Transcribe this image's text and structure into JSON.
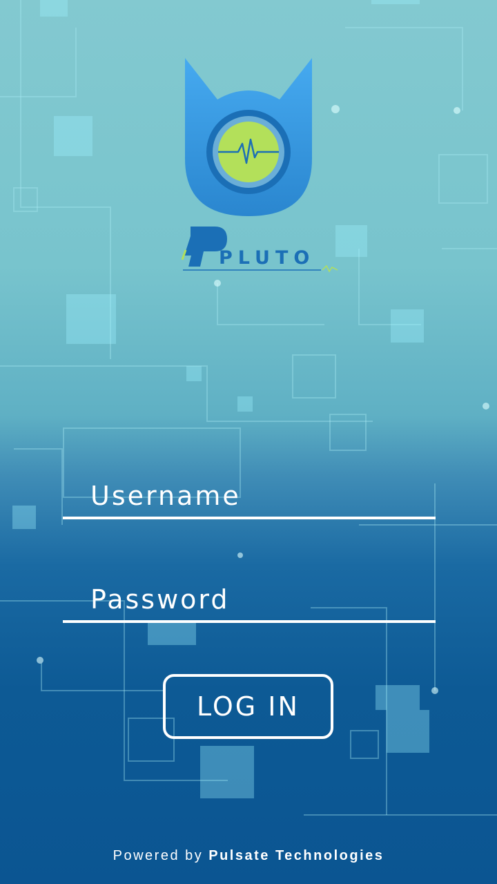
{
  "app": {
    "logo_text": "PLUTO"
  },
  "form": {
    "username_placeholder": "Username",
    "password_placeholder": "Password",
    "login_label": "LOG IN"
  },
  "footer": {
    "prefix": "Powered  by",
    "company": "Pulsate  Technologies"
  },
  "colors": {
    "logo_blue": "#3a9be0",
    "logo_dark_blue": "#1b6fb6",
    "logo_green": "#b3e05a",
    "background_top": "#83c9d0",
    "background_bottom": "#0b5592",
    "foreground": "#ffffff"
  }
}
